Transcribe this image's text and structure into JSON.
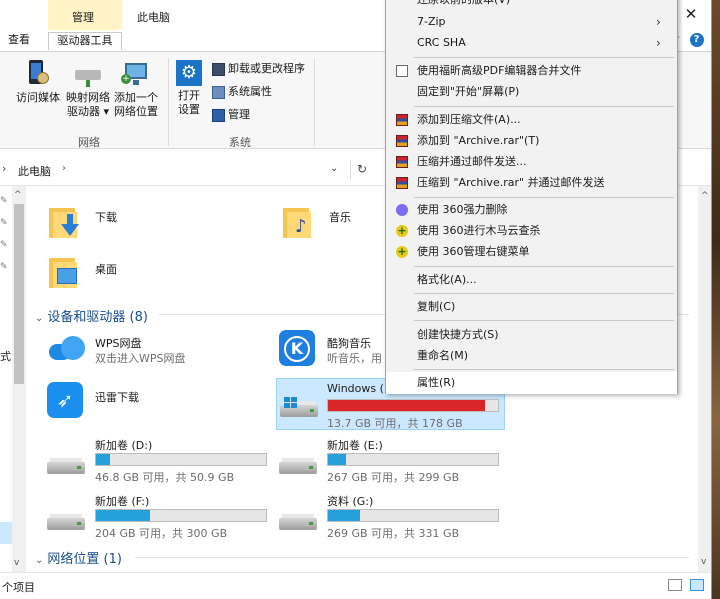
{
  "title": {
    "context_tab": "管理",
    "window_title": "此电脑",
    "close_glyph": "✕"
  },
  "tabs": [
    {
      "label": "查看"
    },
    {
      "label": "驱动器工具"
    }
  ],
  "ribbon": {
    "media_access": "访问媒体",
    "map_drive_line1": "映射网络",
    "map_drive_line2": "驱动器 ▾",
    "add_netloc_line1": "添加一个",
    "add_netloc_line2": "网络位置",
    "open_settings_line1": "打开",
    "open_settings_line2": "设置",
    "uninstall": "卸载或更改程序",
    "sys_props": "系统属性",
    "manage": "管理",
    "group_network": "网络",
    "group_system": "系统"
  },
  "address": {
    "crumb": "此电脑",
    "sep": "›",
    "dropdown": "⌄",
    "refresh": "↻"
  },
  "nav": {
    "partial_label": "式·"
  },
  "folders": [
    {
      "name": "下载"
    },
    {
      "name": "音乐"
    },
    {
      "name": "桌面"
    }
  ],
  "sections": {
    "devices": "设备和驱动器 (8)",
    "network": "网络位置 (1)"
  },
  "apps": [
    {
      "name": "WPS网盘",
      "sub": "双击进入WPS网盘"
    },
    {
      "name": "酷狗音乐",
      "sub": "听音乐，用"
    },
    {
      "name": "迅雷下载",
      "sub": ""
    }
  ],
  "drives": [
    {
      "name": "Windows (",
      "free_text": "13.7 GB 可用，共 178 GB",
      "used_fraction": 0.923
    },
    {
      "name": "新加卷 (D:)",
      "free_text": "46.8 GB 可用，共 50.9 GB",
      "used_fraction": 0.081
    },
    {
      "name": "新加卷 (E:)",
      "free_text": "267 GB 可用，共 299 GB",
      "used_fraction": 0.107
    },
    {
      "name": "新加卷 (F:)",
      "free_text": "204 GB 可用，共 300 GB",
      "used_fraction": 0.32
    },
    {
      "name": "资料 (G:)",
      "free_text": "269 GB 可用，共 331 GB",
      "used_fraction": 0.187
    }
  ],
  "status": {
    "items_text": "个项目"
  },
  "context_menu": {
    "items": [
      {
        "label": "还原以前的版本(V)",
        "icon": "",
        "submenu": false
      },
      {
        "label": "7-Zip",
        "icon": "",
        "submenu": true
      },
      {
        "label": "CRC SHA",
        "icon": "",
        "submenu": true
      },
      {
        "label": "使用福昕高级PDF编辑器合并文件",
        "icon": "foxit-icon",
        "submenu": false
      },
      {
        "label": "固定到\"开始\"屏幕(P)",
        "icon": "",
        "submenu": false
      },
      {
        "label": "添加到压缩文件(A)...",
        "icon": "winrar-icon",
        "submenu": false
      },
      {
        "label": "添加到 \"Archive.rar\"(T)",
        "icon": "winrar-icon",
        "submenu": false
      },
      {
        "label": "压缩并通过邮件发送...",
        "icon": "winrar-icon",
        "submenu": false
      },
      {
        "label": "压缩到 \"Archive.rar\" 并通过邮件发送",
        "icon": "winrar-icon",
        "submenu": false
      },
      {
        "label": "使用 360强力删除",
        "icon": "360-delete-icon",
        "submenu": false
      },
      {
        "label": "使用 360进行木马云查杀",
        "icon": "360-icon",
        "submenu": false
      },
      {
        "label": "使用 360管理右键菜单",
        "icon": "360-icon",
        "submenu": false
      },
      {
        "label": "格式化(A)...",
        "icon": "",
        "submenu": false
      },
      {
        "label": "复制(C)",
        "icon": "",
        "submenu": false
      },
      {
        "label": "创建快捷方式(S)",
        "icon": "",
        "submenu": false
      },
      {
        "label": "重命名(M)",
        "icon": "",
        "submenu": false
      },
      {
        "label": "属性(R)",
        "icon": "",
        "submenu": false
      }
    ],
    "submenu_glyph": "›",
    "icon_360_glyph": "+"
  },
  "colors": {
    "accent": "#1a73c7",
    "drive_bar": "#26a0da",
    "drive_bar_full": "#da2626",
    "selection": "#cce8ff",
    "context_tab_bg": "#fff4c6"
  }
}
